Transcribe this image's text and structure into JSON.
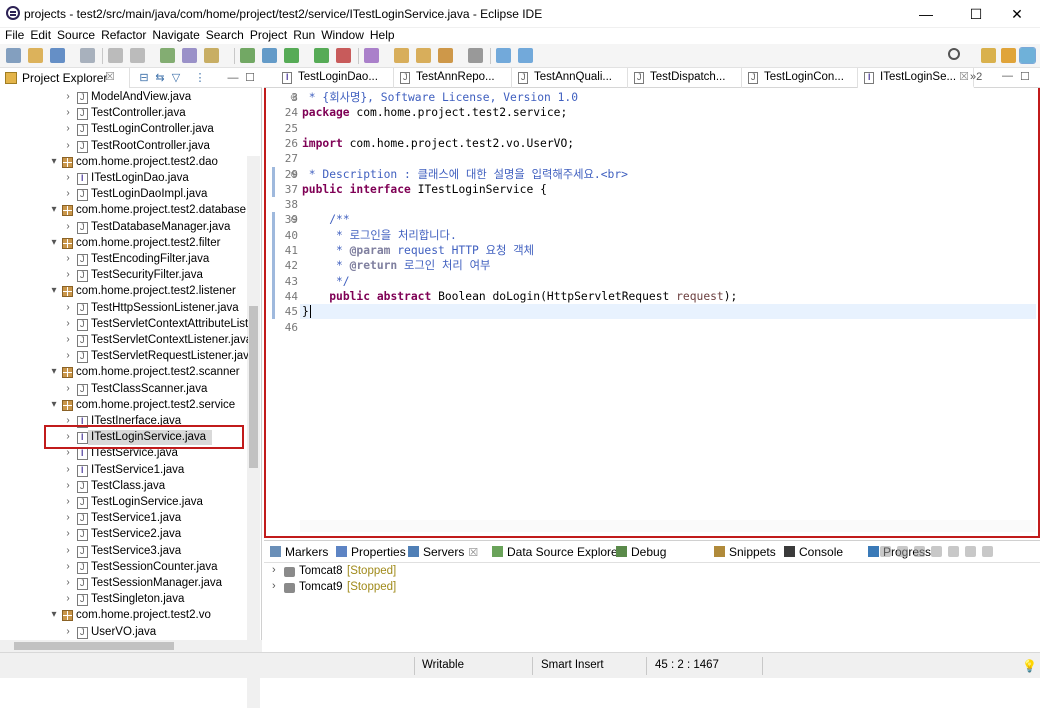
{
  "window": {
    "title": "projects - test2/src/main/java/com/home/project/test2/service/ITestLoginService.java - Eclipse IDE",
    "minimize_glyph": "—",
    "maximize_glyph": "☐",
    "close_glyph": "✕"
  },
  "menu": [
    "File",
    "Edit",
    "Source",
    "Refactor",
    "Navigate",
    "Search",
    "Project",
    "Run",
    "Window",
    "Help"
  ],
  "explorer": {
    "title": "Project Explorer",
    "close_glyph": "☒",
    "tree": [
      {
        "type": "file",
        "label": "ModelAndView.java",
        "depth": 2
      },
      {
        "type": "file",
        "label": "TestController.java",
        "depth": 2
      },
      {
        "type": "file",
        "label": "TestLoginController.java",
        "depth": 2
      },
      {
        "type": "file",
        "label": "TestRootController.java",
        "depth": 2
      },
      {
        "type": "package",
        "label": "com.home.project.test2.dao",
        "depth": 1
      },
      {
        "type": "iface",
        "label": "ITestLoginDao.java",
        "depth": 2
      },
      {
        "type": "file",
        "label": "TestLoginDaoImpl.java",
        "depth": 2
      },
      {
        "type": "package",
        "label": "com.home.project.test2.database",
        "depth": 1
      },
      {
        "type": "file",
        "label": "TestDatabaseManager.java",
        "depth": 2
      },
      {
        "type": "package",
        "label": "com.home.project.test2.filter",
        "depth": 1
      },
      {
        "type": "file",
        "label": "TestEncodingFilter.java",
        "depth": 2
      },
      {
        "type": "file",
        "label": "TestSecurityFilter.java",
        "depth": 2
      },
      {
        "type": "package",
        "label": "com.home.project.test2.listener",
        "depth": 1
      },
      {
        "type": "file",
        "label": "TestHttpSessionListener.java",
        "depth": 2
      },
      {
        "type": "file",
        "label": "TestServletContextAttributeListe",
        "depth": 2
      },
      {
        "type": "file",
        "label": "TestServletContextListener.java",
        "depth": 2
      },
      {
        "type": "file",
        "label": "TestServletRequestListener.java",
        "depth": 2
      },
      {
        "type": "package",
        "label": "com.home.project.test2.scanner",
        "depth": 1
      },
      {
        "type": "file",
        "label": "TestClassScanner.java",
        "depth": 2
      },
      {
        "type": "package",
        "label": "com.home.project.test2.service",
        "depth": 1
      },
      {
        "type": "iface",
        "label": "ITestInerface.java",
        "depth": 2
      },
      {
        "type": "iface",
        "label": "ITestLoginService.java",
        "depth": 2,
        "selected": true
      },
      {
        "type": "iface",
        "label": "ITestService.java",
        "depth": 2
      },
      {
        "type": "iface",
        "label": "ITestService1.java",
        "depth": 2
      },
      {
        "type": "file",
        "label": "TestClass.java",
        "depth": 2
      },
      {
        "type": "file",
        "label": "TestLoginService.java",
        "depth": 2
      },
      {
        "type": "file",
        "label": "TestService1.java",
        "depth": 2
      },
      {
        "type": "file",
        "label": "TestService2.java",
        "depth": 2
      },
      {
        "type": "file",
        "label": "TestService3.java",
        "depth": 2
      },
      {
        "type": "file",
        "label": "TestSessionCounter.java",
        "depth": 2
      },
      {
        "type": "file",
        "label": "TestSessionManager.java",
        "depth": 2
      },
      {
        "type": "file",
        "label": "TestSingleton.java",
        "depth": 2
      },
      {
        "type": "package",
        "label": "com.home.project.test2.vo",
        "depth": 1
      },
      {
        "type": "file",
        "label": "UserVO.java",
        "depth": 2
      }
    ]
  },
  "editor": {
    "tabs": [
      {
        "label": "TestLoginDao...",
        "kind": "iface"
      },
      {
        "label": "TestAnnRepo...",
        "kind": "file"
      },
      {
        "label": "TestAnnQuali...",
        "kind": "file"
      },
      {
        "label": "TestDispatch...",
        "kind": "file"
      },
      {
        "label": "TestLoginCon...",
        "kind": "file"
      },
      {
        "label": "ITestLoginSe...",
        "kind": "iface",
        "active": true,
        "close": "☒"
      }
    ],
    "overflow": "»2",
    "lines": [
      {
        "num": "3",
        "fold": "+",
        "html": "<span class='cm'> * {회사명}, Software License, Version 1.0</span>"
      },
      {
        "num": "24",
        "html": "<span class='kw'>package</span> com.home.project.test2.service;"
      },
      {
        "num": "25",
        "html": ""
      },
      {
        "num": "26",
        "html": "<span class='kw'>import</span> com.home.project.test2.vo.UserVO;"
      },
      {
        "num": "27",
        "html": ""
      },
      {
        "num": "29",
        "fold": "+",
        "html": "<span class='cm'> * Description : 클래스에 대한 설명을 입력해주세요.&lt;br&gt;</span>"
      },
      {
        "num": "37",
        "html": "<span class='kw'>public</span> <span class='kw'>interface</span> ITestLoginService {"
      },
      {
        "num": "38",
        "html": ""
      },
      {
        "num": "39",
        "fold": "-",
        "html": "    <span class='cm'>/**</span>"
      },
      {
        "num": "40",
        "html": "<span class='cm'>     * 로그인을 처리합니다.</span>"
      },
      {
        "num": "41",
        "html": "<span class='cm'>     * <span class='tg'>@param</span> request HTTP 요청 객체</span>"
      },
      {
        "num": "42",
        "html": "<span class='cm'>     * <span class='tg'>@return</span> 로그인 처리 여부</span>"
      },
      {
        "num": "43",
        "html": "<span class='cm'>     */</span>"
      },
      {
        "num": "44",
        "html": "    <span class='kw'>public</span> <span class='kw'>abstract</span> Boolean doLogin(HttpServletRequest <span class='st'>request</span>);"
      },
      {
        "num": "45",
        "html": "}",
        "current": true
      },
      {
        "num": "46",
        "html": ""
      }
    ]
  },
  "bottom": {
    "tabs": [
      {
        "label": "Markers"
      },
      {
        "label": "Properties"
      },
      {
        "label": "Servers",
        "active": true,
        "close": "☒"
      },
      {
        "label": "Data Source Explorer"
      },
      {
        "label": "Debug"
      },
      {
        "label": "Snippets"
      },
      {
        "label": "Console"
      },
      {
        "label": "Progress"
      }
    ],
    "servers": [
      {
        "name": "Tomcat8",
        "state": "[Stopped]"
      },
      {
        "name": "Tomcat9",
        "state": "[Stopped]"
      }
    ]
  },
  "status": {
    "mode": "Writable",
    "insert": "Smart Insert",
    "position": "45 : 2 : 1467"
  },
  "colors": {
    "highlight_box": "#c11b1b",
    "keyword": "#7f0055",
    "comment": "#3f5fbf"
  }
}
